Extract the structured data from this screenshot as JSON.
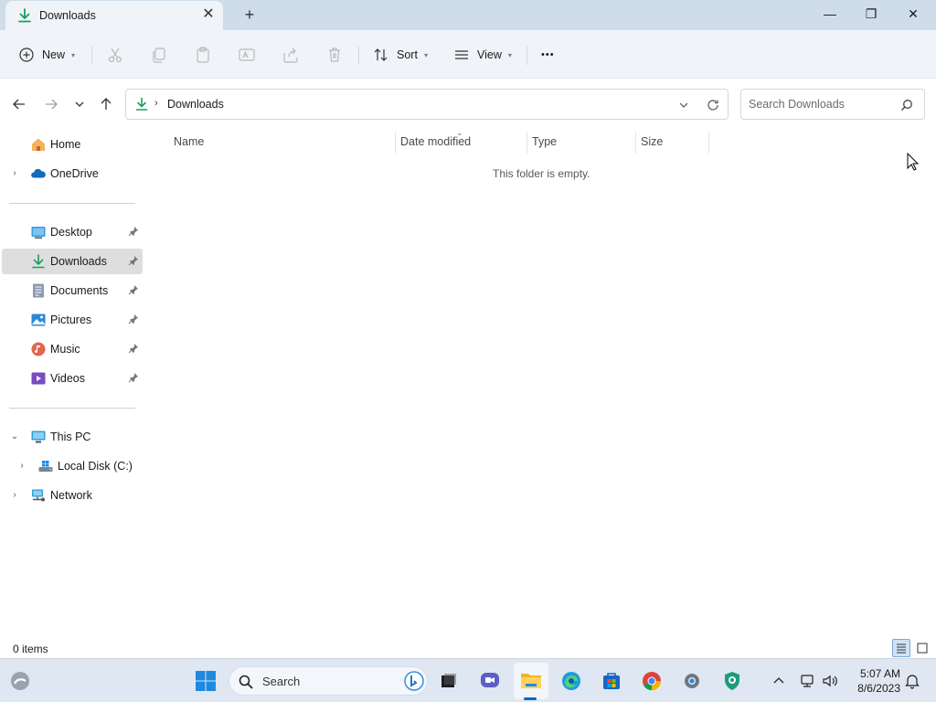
{
  "window": {
    "tab_title": "Downloads",
    "tab_close": "✕",
    "new_tab": "+",
    "controls": {
      "minimize": "—",
      "maximize": "❐",
      "close": "✕"
    }
  },
  "toolbar": {
    "new_label": "New",
    "sort_label": "Sort",
    "view_label": "View",
    "more_label": "•••",
    "icons": [
      "plus-circle-icon",
      "cut-icon",
      "copy-icon",
      "paste-icon",
      "rename-icon",
      "share-icon",
      "delete-icon",
      "sort-icon",
      "view-icon",
      "more-icon"
    ]
  },
  "navigation": {
    "breadcrumb": [
      "Downloads"
    ],
    "search_placeholder": "Search Downloads"
  },
  "sidebar": {
    "items": [
      {
        "label": "Home",
        "icon": "home-icon",
        "expandable": false
      },
      {
        "label": "OneDrive",
        "icon": "onedrive-icon",
        "expandable": true
      }
    ],
    "quick_access": [
      {
        "label": "Desktop",
        "icon": "desktop-icon",
        "pinned": true
      },
      {
        "label": "Downloads",
        "icon": "downloads-icon",
        "pinned": true,
        "selected": true
      },
      {
        "label": "Documents",
        "icon": "documents-icon",
        "pinned": true
      },
      {
        "label": "Pictures",
        "icon": "pictures-icon",
        "pinned": true
      },
      {
        "label": "Music",
        "icon": "music-icon",
        "pinned": true
      },
      {
        "label": "Videos",
        "icon": "videos-icon",
        "pinned": true
      }
    ],
    "devices": [
      {
        "label": "This PC",
        "icon": "this-pc-icon",
        "expanded": true
      },
      {
        "label": "Local Disk (C:)",
        "icon": "disk-icon",
        "expanded": false
      },
      {
        "label": "Network",
        "icon": "network-icon",
        "expanded": false
      }
    ]
  },
  "content": {
    "columns": [
      "Name",
      "Date modified",
      "Type",
      "Size"
    ],
    "empty_message": "This folder is empty."
  },
  "status": {
    "item_count": "0 items"
  },
  "taskbar": {
    "search_label": "Search",
    "time": "5:07 AM",
    "date": "8/6/2023",
    "apps": [
      "start-icon",
      "search-icon",
      "bing-icon",
      "task-view-icon",
      "chat-icon",
      "file-explorer-icon",
      "edge-icon",
      "store-icon",
      "chrome-icon",
      "settings-icon",
      "security-icon"
    ]
  },
  "colors": {
    "accent": "#0067c0",
    "download_green": "#1a9e5c",
    "titlebar_bg": "#cfdcea",
    "commandbar_bg": "#f0f4f9",
    "selected_bg": "#dedede"
  }
}
